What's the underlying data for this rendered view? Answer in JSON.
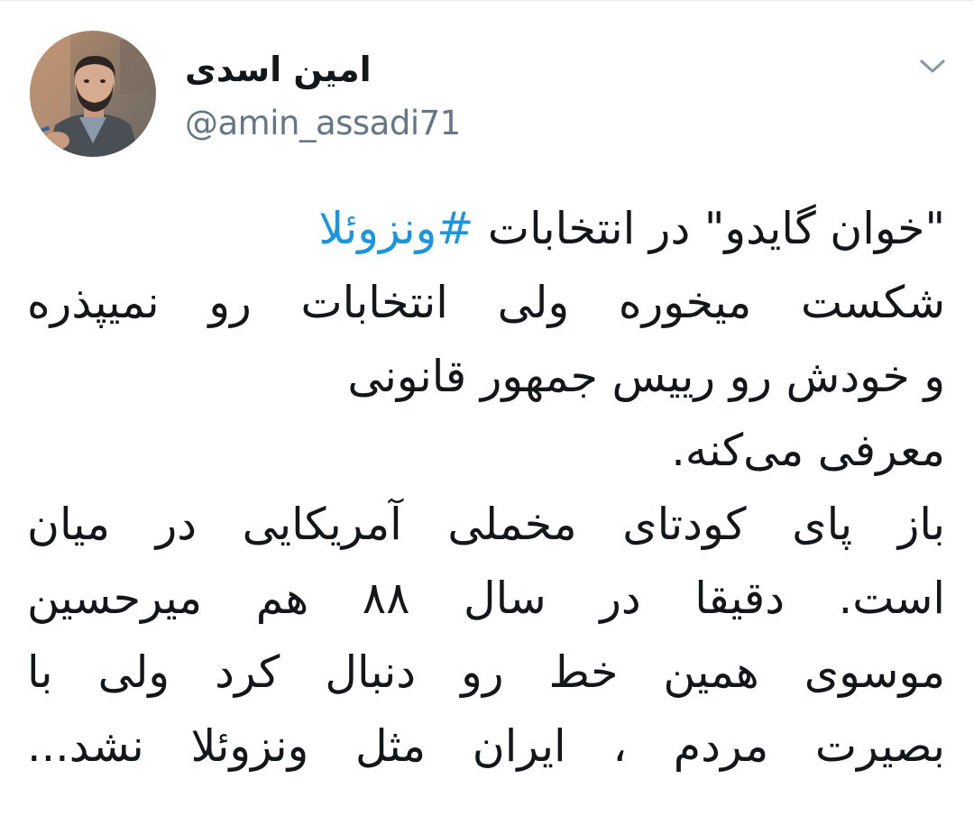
{
  "author": {
    "display_name": "امین اسدی",
    "handle": "@amin_assadi71"
  },
  "icons": {
    "menu": "chevron-down-icon",
    "avatar": "profile-photo"
  },
  "colors": {
    "text": "#14171a",
    "secondary": "#657786",
    "link": "#1b95e0"
  },
  "tweet": {
    "line1_prefix": "\"خوان گایدو\" در انتخابات ",
    "line1_hashtag": "#ونزوئلا",
    "line2": "شکست میخوره ولی انتخابات رو نمیپذره",
    "line3": "و خودش رو رییس جمهور قانونی",
    "line4": "معرفی می‌کنه.",
    "line5": "باز پای کودتای مخملی آمریکایی در میان",
    "line6": "است. دقیقا در سال ۸۸ هم میرحسین",
    "line7": "موسوی همین خط رو دنبال کرد ولی با",
    "line8": "بصیرت مردم ، ایران مثل ونزوئلا نشد..."
  }
}
